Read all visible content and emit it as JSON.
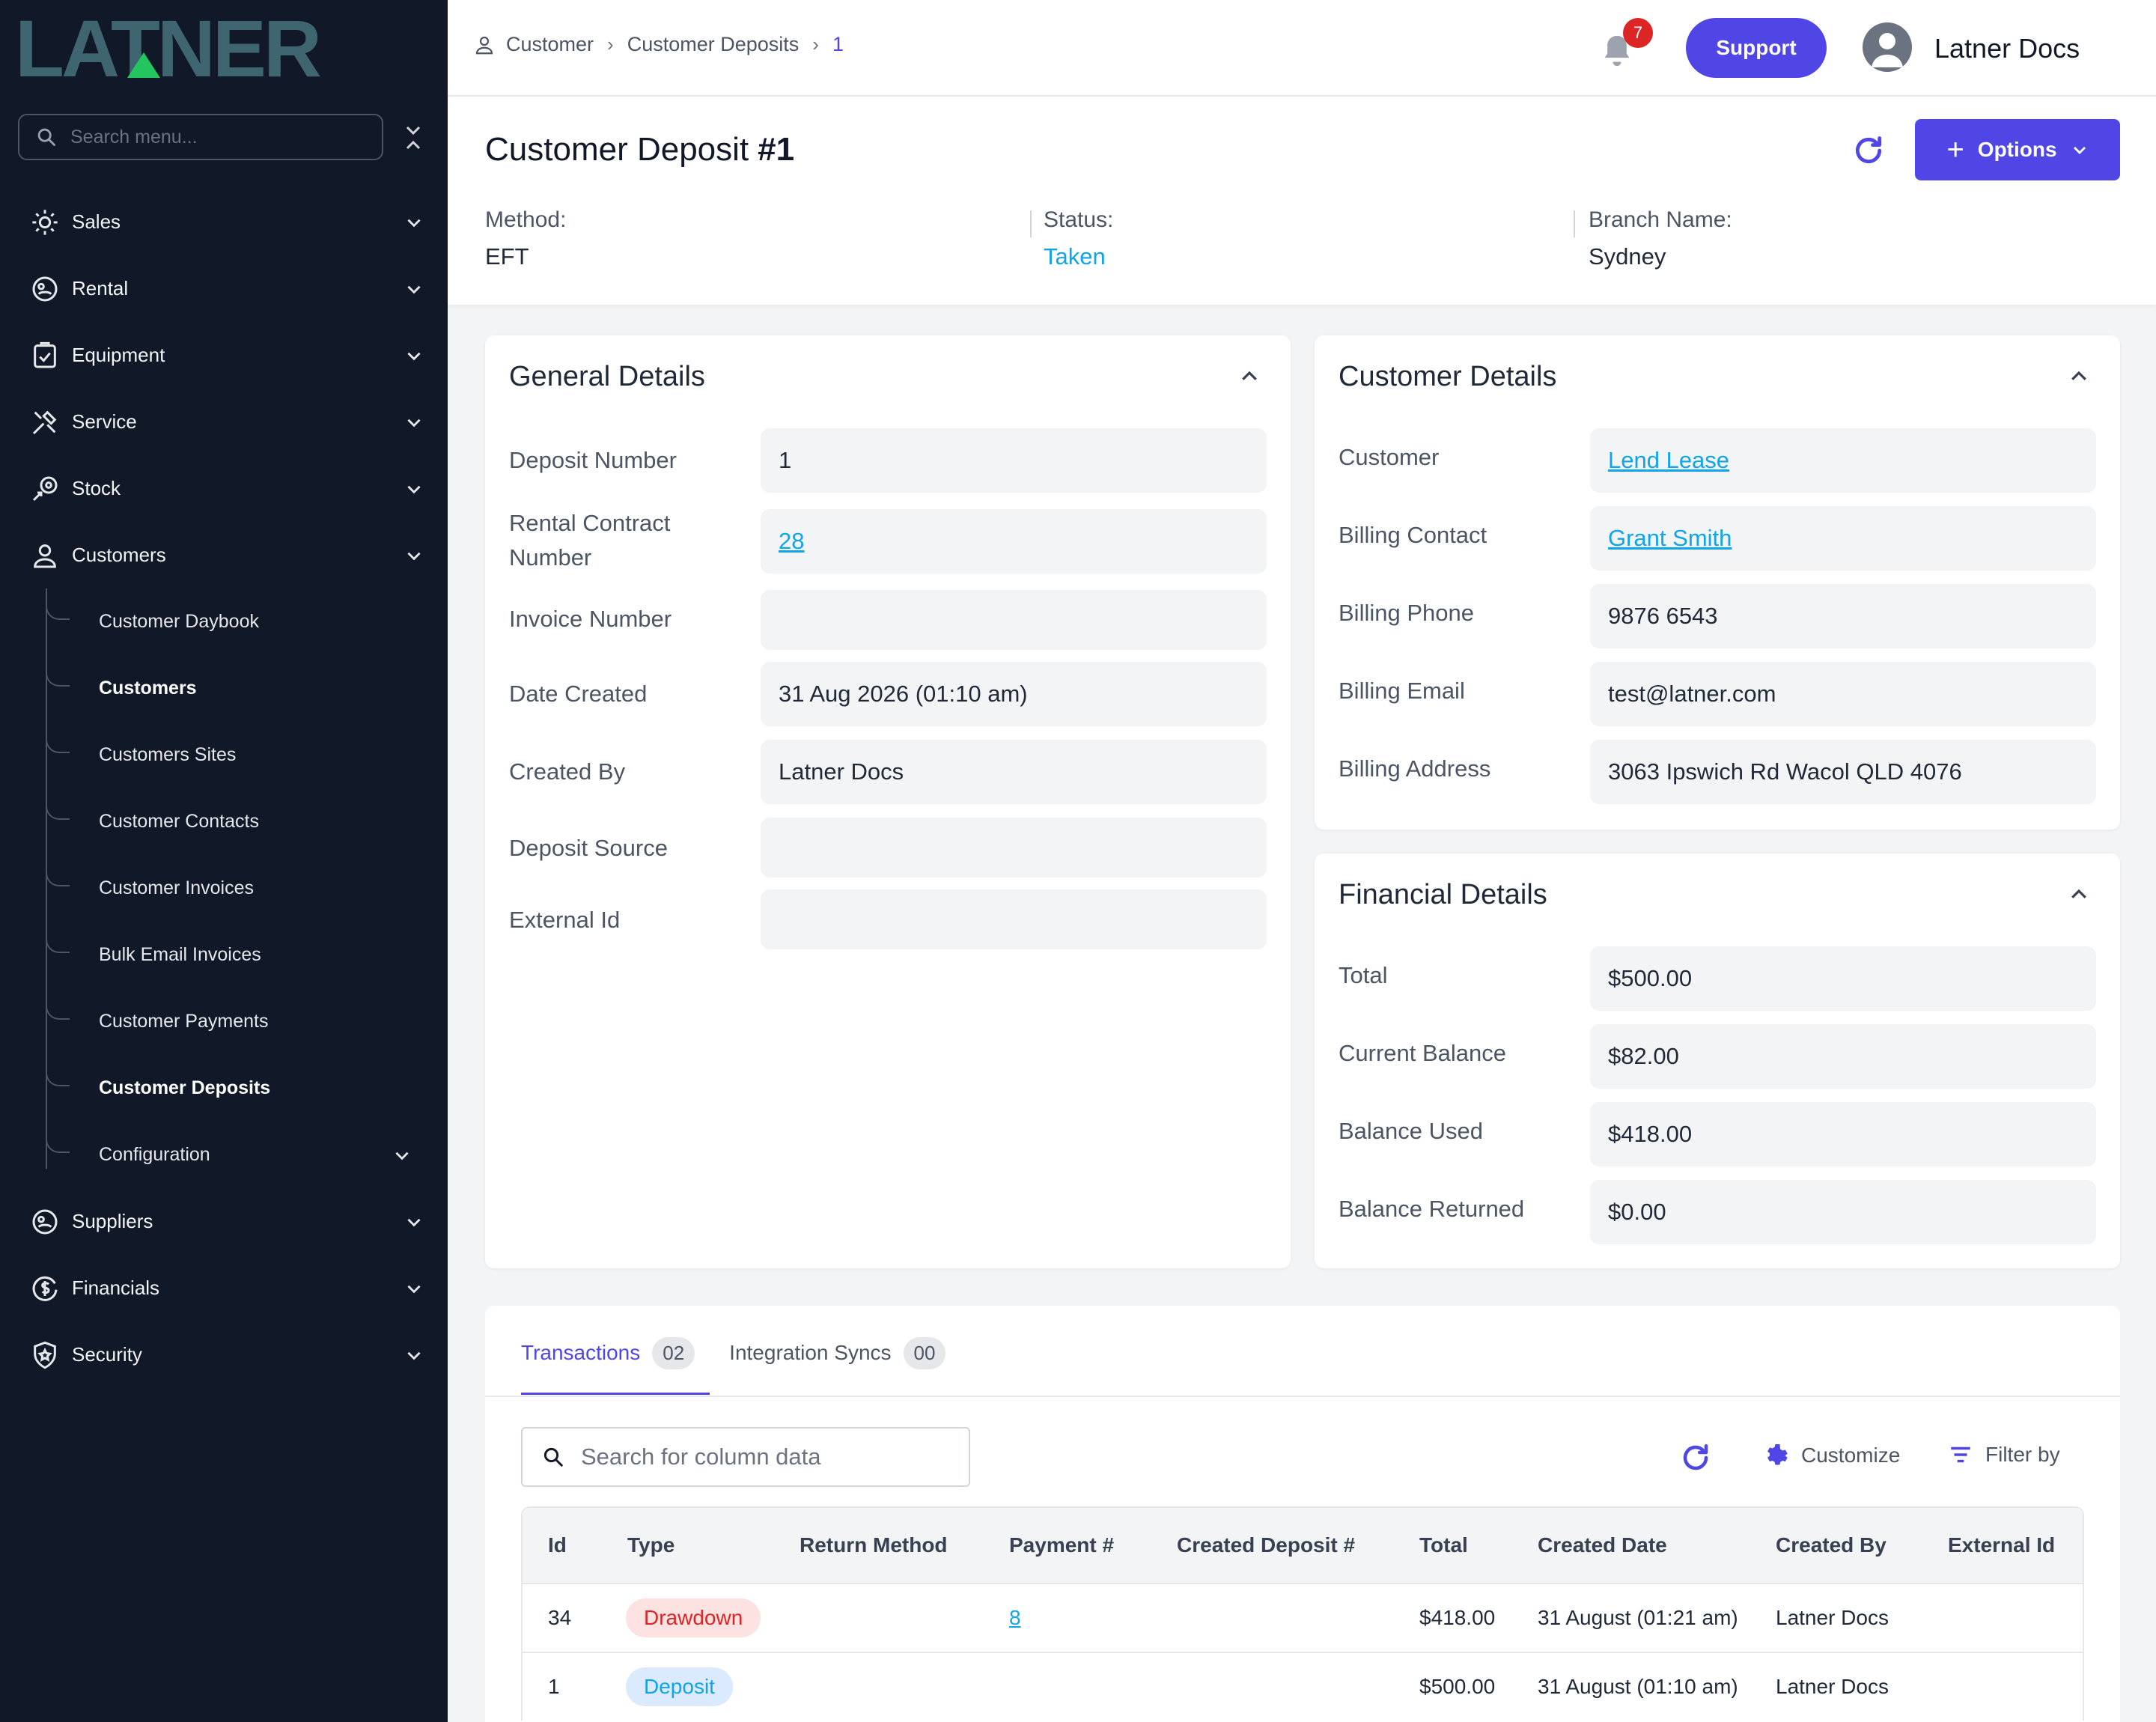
{
  "brand": {
    "logo_text": "LATNER"
  },
  "sidebar": {
    "search_placeholder": "Search menu...",
    "items": [
      {
        "label": "Sales",
        "icon": "sales-icon"
      },
      {
        "label": "Rental",
        "icon": "rental-icon"
      },
      {
        "label": "Equipment",
        "icon": "equipment-icon"
      },
      {
        "label": "Service",
        "icon": "service-icon"
      },
      {
        "label": "Stock",
        "icon": "stock-icon"
      },
      {
        "label": "Customers",
        "icon": "user-icon"
      }
    ],
    "sub_items": [
      {
        "label": "Customer Daybook"
      },
      {
        "label": "Customers"
      },
      {
        "label": "Customers Sites"
      },
      {
        "label": "Customer Contacts"
      },
      {
        "label": "Customer Invoices"
      },
      {
        "label": "Bulk Email Invoices"
      },
      {
        "label": "Customer Payments"
      },
      {
        "label": "Customer Deposits"
      },
      {
        "label": "Configuration"
      }
    ],
    "bottom_items": [
      {
        "label": "Suppliers",
        "icon": "suppliers-icon"
      },
      {
        "label": "Financials",
        "icon": "financials-icon"
      },
      {
        "label": "Security",
        "icon": "shield-icon"
      }
    ]
  },
  "topbar": {
    "breadcrumbs": [
      "Customer",
      "Customer Deposits",
      "1"
    ],
    "notification_count": "7",
    "support_label": "Support",
    "user_name": "Latner Docs"
  },
  "header": {
    "title": "Customer Deposit",
    "title_number": "#1",
    "options_label": "Options",
    "meta": [
      {
        "key": "Method:",
        "value": "EFT"
      },
      {
        "key": "Status:",
        "value": "Taken"
      },
      {
        "key": "Branch Name:",
        "value": "Sydney"
      }
    ]
  },
  "general": {
    "title": "General Details",
    "rows": [
      {
        "key": "Deposit Number",
        "value": "1"
      },
      {
        "key": "Rental Contract Number",
        "value": "28"
      },
      {
        "key": "Invoice Number",
        "value": ""
      },
      {
        "key": "Date Created",
        "value": "31 Aug 2026 (01:10 am)"
      },
      {
        "key": "Created By",
        "value": "Latner Docs"
      },
      {
        "key": "Deposit Source",
        "value": ""
      },
      {
        "key": "External Id",
        "value": ""
      }
    ]
  },
  "customer": {
    "title": "Customer Details",
    "rows": [
      {
        "key": "Customer",
        "value": "Lend Lease"
      },
      {
        "key": "Billing Contact",
        "value": "Grant Smith"
      },
      {
        "key": "Billing Phone",
        "value": "9876 6543"
      },
      {
        "key": "Billing Email",
        "value": "test@latner.com"
      },
      {
        "key": "Billing Address",
        "value": "3063 Ipswich Rd Wacol QLD 4076"
      }
    ]
  },
  "financial": {
    "title": "Financial Details",
    "rows": [
      {
        "key": "Total",
        "value": "$500.00"
      },
      {
        "key": "Current Balance",
        "value": "$82.00"
      },
      {
        "key": "Balance Used",
        "value": "$418.00"
      },
      {
        "key": "Balance Returned",
        "value": "$0.00"
      }
    ]
  },
  "transactions": {
    "tabs": [
      {
        "label": "Transactions",
        "count": "02"
      },
      {
        "label": "Integration Syncs",
        "count": "00"
      }
    ],
    "search_placeholder": "Search for column data",
    "customize_label": "Customize",
    "filter_label": "Filter by",
    "columns": [
      "Id",
      "Type",
      "Return Method",
      "Payment #",
      "Created Deposit #",
      "Total",
      "Created Date",
      "Created By",
      "External Id"
    ],
    "rows": [
      {
        "id": "34",
        "type": "Drawdown",
        "return_method": "",
        "payment": "8",
        "created_deposit": "",
        "total": "$418.00",
        "created_date": "31 August (01:21 am)",
        "created_by": "Latner Docs",
        "external_id": ""
      },
      {
        "id": "1",
        "type": "Deposit",
        "return_method": "",
        "payment": "",
        "created_deposit": "",
        "total": "$500.00",
        "created_date": "31 August (01:10 am)",
        "created_by": "Latner Docs",
        "external_id": ""
      }
    ]
  },
  "colors": {
    "accent": "#4f46e5",
    "sidebar_bg": "#111827",
    "link": "#0ea5e9",
    "logo": "#3f6670",
    "logo_triangle": "#22c55e"
  }
}
